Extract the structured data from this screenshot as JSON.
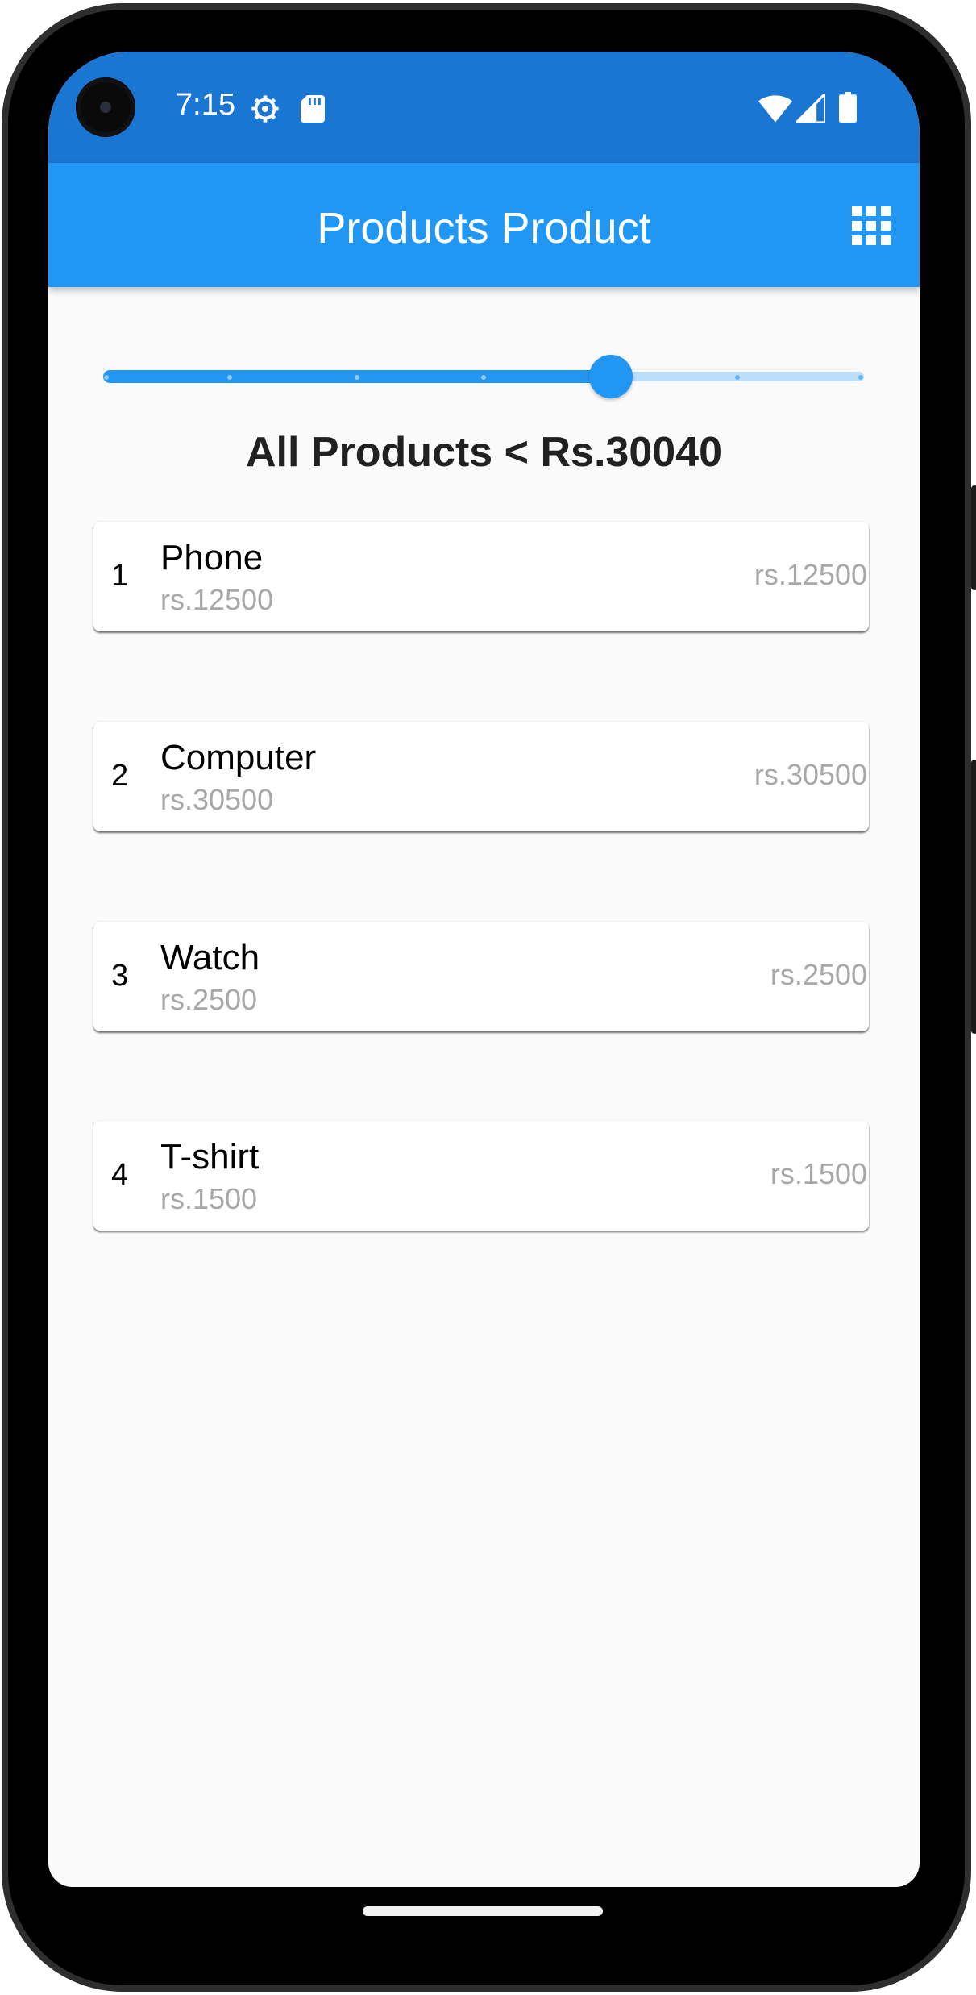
{
  "status_bar": {
    "time": "7:15",
    "left_icons": [
      "settings-gear-icon",
      "sd-card-icon"
    ],
    "right_icons": [
      "wifi-icon",
      "signal-icon",
      "battery-icon"
    ]
  },
  "app_bar": {
    "title": "Products Product",
    "action_icon": "grid-view-icon"
  },
  "slider": {
    "value_fraction": 0.667,
    "divisions": 6,
    "active_color": "#2196f3",
    "inactive_color": "#bbdefb"
  },
  "heading": "All Products < Rs.30040",
  "products": [
    {
      "index": "1",
      "name": "Phone",
      "subtitle": "rs.12500",
      "price": "rs.12500"
    },
    {
      "index": "2",
      "name": "Computer",
      "subtitle": "rs.30500",
      "price": "rs.30500"
    },
    {
      "index": "3",
      "name": "Watch",
      "subtitle": "rs.2500",
      "price": "rs.2500"
    },
    {
      "index": "4",
      "name": "T-shirt",
      "subtitle": "rs.1500",
      "price": "rs.1500"
    }
  ],
  "colors": {
    "status_bar": "#1976d2",
    "app_bar": "#2196f3",
    "background": "#fafafa",
    "secondary_text": "#a8a8a8"
  }
}
